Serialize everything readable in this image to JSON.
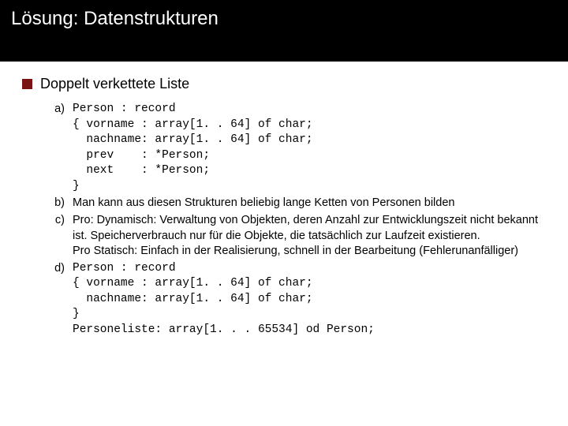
{
  "header": {
    "title": "Lösung: Datenstrukturen"
  },
  "bullet": {
    "title": "Doppelt verkettete Liste"
  },
  "items": {
    "a": {
      "letter": "a)",
      "code": "Person : record\n{ vorname : array[1. . 64] of char;\n  nachname: array[1. . 64] of char;\n  prev    : *Person;\n  next    : *Person;\n}"
    },
    "b": {
      "letter": "b)",
      "text": "Man kann aus diesen Strukturen beliebig lange Ketten von Personen bilden"
    },
    "c": {
      "letter": "c)",
      "text": "Pro: Dynamisch: Verwaltung von Objekten, deren Anzahl zur Entwicklungszeit nicht bekannt ist. Speicherverbrauch nur für die Objekte, die tatsächlich zur Laufzeit existieren.\nPro Statisch: Einfach in der Realisierung, schnell in der Bearbeitung (Fehlerunanfälliger)"
    },
    "d": {
      "letter": "d)",
      "code": "Person : record\n{ vorname : array[1. . 64] of char;\n  nachname: array[1. . 64] of char;\n}\nPersoneliste: array[1. . . 65534] od Person;"
    }
  }
}
